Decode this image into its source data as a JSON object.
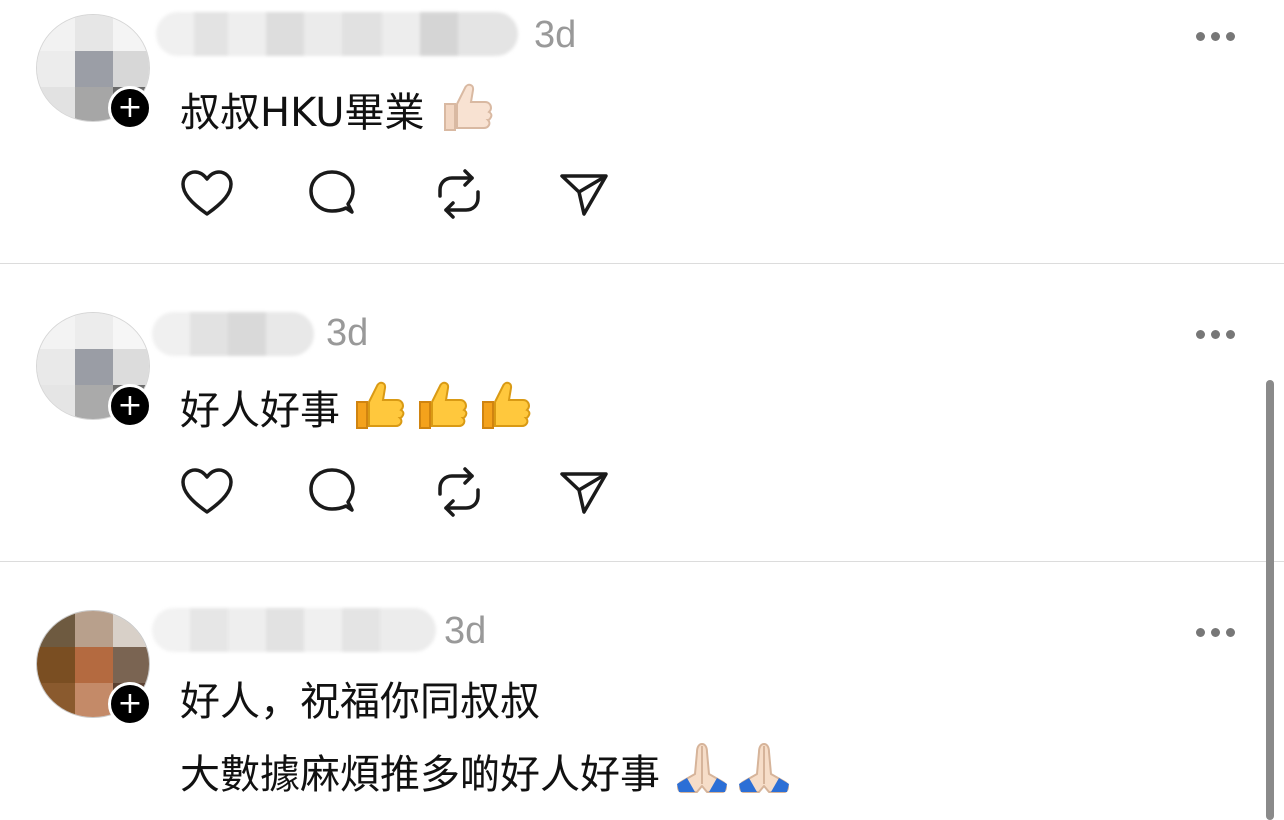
{
  "posts": [
    {
      "time": "3d",
      "text": "叔叔HKU畢業",
      "emoji": "thumbs-up-light"
    },
    {
      "time": "3d",
      "text": "好人好事",
      "emoji": "thumbs-up-yellow-x3"
    },
    {
      "time": "3d",
      "text_line1": "好人，祝福你同叔叔",
      "text_line2": "大數據麻煩推多啲好人好事",
      "emoji": "folded-hands-x2"
    }
  ],
  "icons": [
    "heart-icon",
    "comment-icon",
    "repost-icon",
    "share-icon",
    "more-icon",
    "plus-icon"
  ],
  "colors": {
    "time": "#999999",
    "divider": "#dcdcdc",
    "icon_stroke": "#1a1a1a"
  }
}
